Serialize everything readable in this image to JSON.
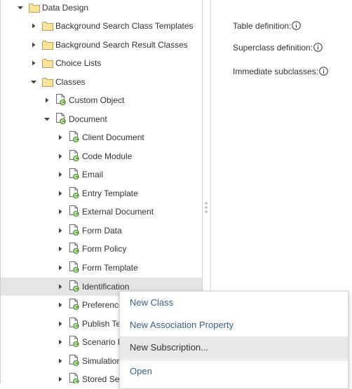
{
  "colors": {
    "folder_fill": "#f5e39a",
    "folder_stroke": "#b8a25a",
    "class_badge": "#5ea23a",
    "selected_row": "#e5e5e5",
    "menu_text": "#3b5e8a"
  },
  "tree": {
    "items": [
      {
        "label": "Data Design",
        "icon": "folder-icon",
        "expanded": true
      },
      {
        "label": "Background Search Class Templates",
        "icon": "folder-icon",
        "expanded": false
      },
      {
        "label": "Background Search Result Classes",
        "icon": "folder-icon",
        "expanded": false
      },
      {
        "label": "Choice Lists",
        "icon": "folder-icon",
        "expanded": false
      },
      {
        "label": "Classes",
        "icon": "folder-icon",
        "expanded": true
      },
      {
        "label": "Custom Object",
        "icon": "class-icon",
        "expanded": false
      },
      {
        "label": "Document",
        "icon": "class-icon",
        "expanded": true
      },
      {
        "label": "Client Document",
        "icon": "class-icon",
        "expanded": false
      },
      {
        "label": "Code Module",
        "icon": "class-icon",
        "expanded": false
      },
      {
        "label": "Email",
        "icon": "class-icon",
        "expanded": false
      },
      {
        "label": "Entry Template",
        "icon": "class-icon",
        "expanded": false
      },
      {
        "label": "External Document",
        "icon": "class-icon",
        "expanded": false
      },
      {
        "label": "Form Data",
        "icon": "class-icon",
        "expanded": false
      },
      {
        "label": "Form Policy",
        "icon": "class-icon",
        "expanded": false
      },
      {
        "label": "Form Template",
        "icon": "class-icon",
        "expanded": false
      },
      {
        "label": "Identification",
        "icon": "class-icon",
        "expanded": false,
        "selected": true
      },
      {
        "label": "Preference",
        "icon": "class-icon",
        "expanded": false
      },
      {
        "label": "Publish Te",
        "icon": "class-icon",
        "expanded": false
      },
      {
        "label": "Scenario D",
        "icon": "class-icon",
        "expanded": false
      },
      {
        "label": "Simulation",
        "icon": "class-icon",
        "expanded": false
      },
      {
        "label": "Stored Se",
        "icon": "class-icon",
        "expanded": false
      }
    ]
  },
  "properties": {
    "table_definition": "Table definition:",
    "superclass_definition": "Superclass definition:",
    "immediate_subclasses": "Immediate subclasses:"
  },
  "context_menu": {
    "items": [
      {
        "label": "New Class"
      },
      {
        "label": "New Association Property"
      },
      {
        "label": "New Subscription...",
        "hover": true
      },
      {
        "label": "Open"
      }
    ]
  }
}
